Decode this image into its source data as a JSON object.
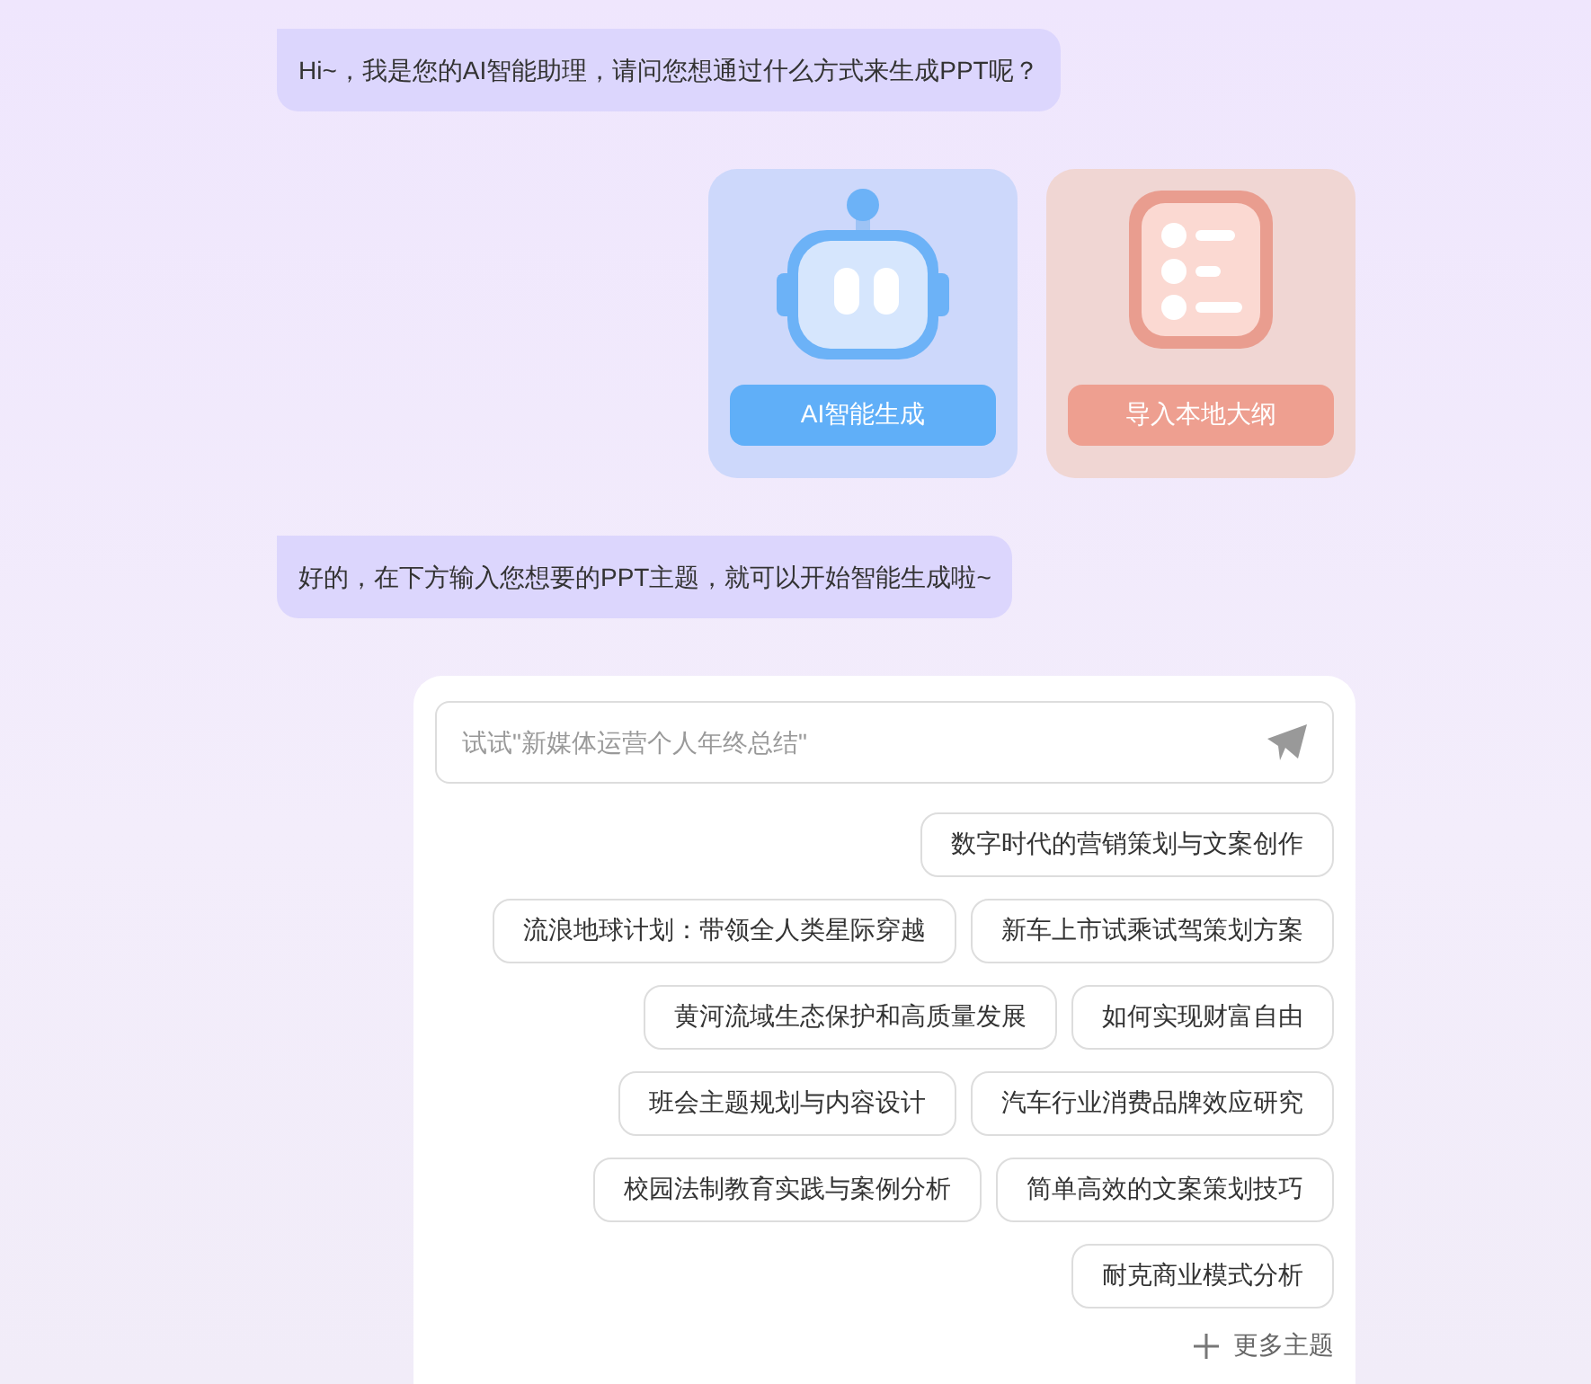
{
  "messages_top": {
    "text": "Hi~，我是您的AI智能助理，请问您想通过什么方式来生成PPT呢？"
  },
  "options": [
    {
      "kind": "robot",
      "label": "AI智能生成"
    },
    {
      "kind": "outline",
      "label": "导入本地大纲"
    }
  ],
  "message_second": {
    "text": "好的，在下方输入您想要的PPT主题，就可以开始智能生成啦~"
  },
  "prompt_input": {
    "placeholder": "试试\"新媒体运营个人年终总结\""
  },
  "topic_rows": [
    [
      "数字时代的营销策划与文案创作"
    ],
    [
      "流浪地球计划：带领全人类星际穿越",
      "新车上市试乘试驾策划方案"
    ],
    [
      "黄河流域生态保护和高质量发展",
      "如何实现财富自由"
    ],
    [
      "班会主题规划与内容设计",
      "汽车行业消费品牌效应研究"
    ],
    [
      "校园法制教育实践与案例分析",
      "简单高效的文案策划技巧"
    ],
    [
      "耐克商业模式分析"
    ]
  ],
  "more_topics": "更多主题"
}
